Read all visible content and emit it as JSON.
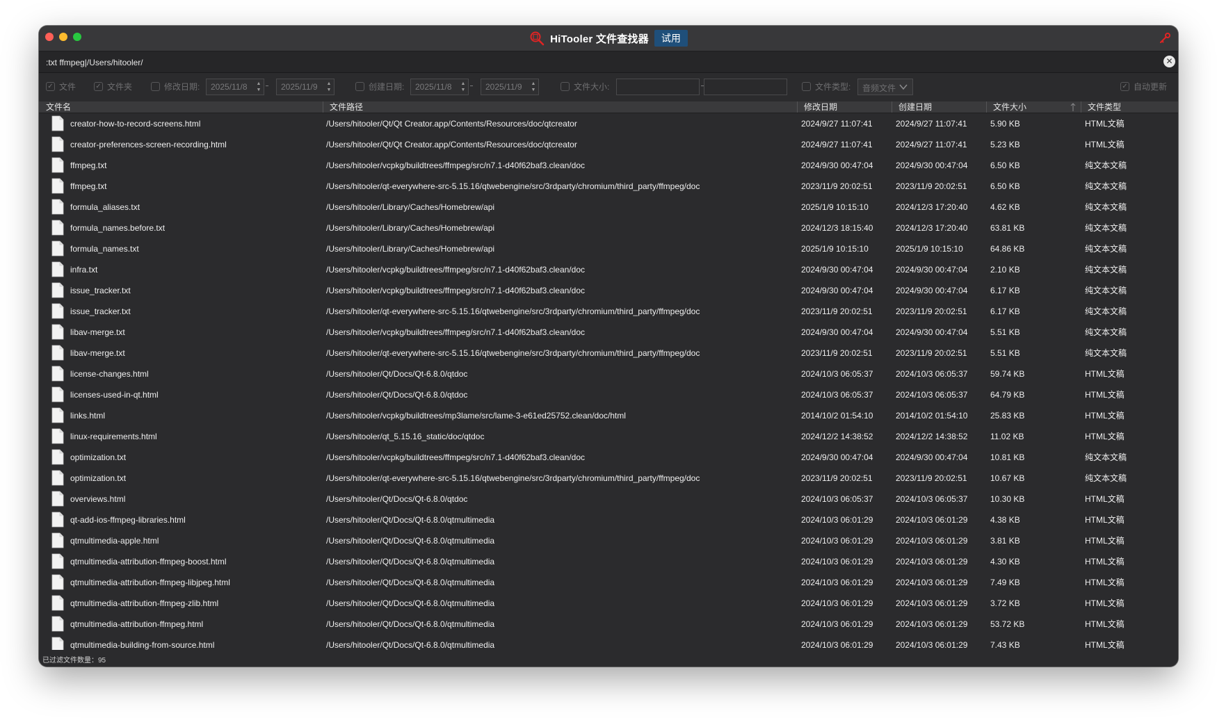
{
  "window": {
    "title": "HiTooler 文件查找器",
    "trial_badge": "试用",
    "icons": {
      "app": "magnifier-document-icon",
      "key": "key-icon",
      "clear": "close-circle-icon"
    }
  },
  "search": {
    "value": ":txt ffmpeg|/Users/hitooler/"
  },
  "filters": {
    "file": {
      "label": "文件",
      "checked": true
    },
    "folder": {
      "label": "文件夹",
      "checked": true
    },
    "modified": {
      "label": "修改日期:",
      "checked": false,
      "from": "2025/11/8",
      "to": "2025/11/9"
    },
    "created": {
      "label": "创建日期:",
      "checked": false,
      "from": "2025/11/8",
      "to": "2025/11/9"
    },
    "size": {
      "label": "文件大小:",
      "checked": false,
      "min": "",
      "max": ""
    },
    "type": {
      "label": "文件类型:",
      "checked": false,
      "selected": "音频文件"
    },
    "auto_refresh": {
      "label": "自动更新",
      "checked": true
    }
  },
  "columns": {
    "name": "文件名",
    "path": "文件路径",
    "modified": "修改日期",
    "created": "创建日期",
    "size": "文件大小",
    "type": "文件类型"
  },
  "rows": [
    {
      "name": "creator-how-to-record-screens.html",
      "path": "/Users/hitooler/Qt/Qt Creator.app/Contents/Resources/doc/qtcreator",
      "modified": "2024/9/27 11:07:41",
      "created": "2024/9/27 11:07:41",
      "size": "5.90 KB",
      "type": "HTML文稿"
    },
    {
      "name": "creator-preferences-screen-recording.html",
      "path": "/Users/hitooler/Qt/Qt Creator.app/Contents/Resources/doc/qtcreator",
      "modified": "2024/9/27 11:07:41",
      "created": "2024/9/27 11:07:41",
      "size": "5.23 KB",
      "type": "HTML文稿"
    },
    {
      "name": "ffmpeg.txt",
      "path": "/Users/hitooler/vcpkg/buildtrees/ffmpeg/src/n7.1-d40f62baf3.clean/doc",
      "modified": "2024/9/30 00:47:04",
      "created": "2024/9/30 00:47:04",
      "size": "6.50 KB",
      "type": "纯文本文稿"
    },
    {
      "name": "ffmpeg.txt",
      "path": "/Users/hitooler/qt-everywhere-src-5.15.16/qtwebengine/src/3rdparty/chromium/third_party/ffmpeg/doc",
      "modified": "2023/11/9 20:02:51",
      "created": "2023/11/9 20:02:51",
      "size": "6.50 KB",
      "type": "纯文本文稿"
    },
    {
      "name": "formula_aliases.txt",
      "path": "/Users/hitooler/Library/Caches/Homebrew/api",
      "modified": "2025/1/9 10:15:10",
      "created": "2024/12/3 17:20:40",
      "size": "4.62 KB",
      "type": "纯文本文稿"
    },
    {
      "name": "formula_names.before.txt",
      "path": "/Users/hitooler/Library/Caches/Homebrew/api",
      "modified": "2024/12/3 18:15:40",
      "created": "2024/12/3 17:20:40",
      "size": "63.81 KB",
      "type": "纯文本文稿"
    },
    {
      "name": "formula_names.txt",
      "path": "/Users/hitooler/Library/Caches/Homebrew/api",
      "modified": "2025/1/9 10:15:10",
      "created": "2025/1/9 10:15:10",
      "size": "64.86 KB",
      "type": "纯文本文稿"
    },
    {
      "name": "infra.txt",
      "path": "/Users/hitooler/vcpkg/buildtrees/ffmpeg/src/n7.1-d40f62baf3.clean/doc",
      "modified": "2024/9/30 00:47:04",
      "created": "2024/9/30 00:47:04",
      "size": "2.10 KB",
      "type": "纯文本文稿"
    },
    {
      "name": "issue_tracker.txt",
      "path": "/Users/hitooler/vcpkg/buildtrees/ffmpeg/src/n7.1-d40f62baf3.clean/doc",
      "modified": "2024/9/30 00:47:04",
      "created": "2024/9/30 00:47:04",
      "size": "6.17 KB",
      "type": "纯文本文稿"
    },
    {
      "name": "issue_tracker.txt",
      "path": "/Users/hitooler/qt-everywhere-src-5.15.16/qtwebengine/src/3rdparty/chromium/third_party/ffmpeg/doc",
      "modified": "2023/11/9 20:02:51",
      "created": "2023/11/9 20:02:51",
      "size": "6.17 KB",
      "type": "纯文本文稿"
    },
    {
      "name": "libav-merge.txt",
      "path": "/Users/hitooler/vcpkg/buildtrees/ffmpeg/src/n7.1-d40f62baf3.clean/doc",
      "modified": "2024/9/30 00:47:04",
      "created": "2024/9/30 00:47:04",
      "size": "5.51 KB",
      "type": "纯文本文稿"
    },
    {
      "name": "libav-merge.txt",
      "path": "/Users/hitooler/qt-everywhere-src-5.15.16/qtwebengine/src/3rdparty/chromium/third_party/ffmpeg/doc",
      "modified": "2023/11/9 20:02:51",
      "created": "2023/11/9 20:02:51",
      "size": "5.51 KB",
      "type": "纯文本文稿"
    },
    {
      "name": "license-changes.html",
      "path": "/Users/hitooler/Qt/Docs/Qt-6.8.0/qtdoc",
      "modified": "2024/10/3 06:05:37",
      "created": "2024/10/3 06:05:37",
      "size": "59.74 KB",
      "type": "HTML文稿"
    },
    {
      "name": "licenses-used-in-qt.html",
      "path": "/Users/hitooler/Qt/Docs/Qt-6.8.0/qtdoc",
      "modified": "2024/10/3 06:05:37",
      "created": "2024/10/3 06:05:37",
      "size": "64.79 KB",
      "type": "HTML文稿"
    },
    {
      "name": "links.html",
      "path": "/Users/hitooler/vcpkg/buildtrees/mp3lame/src/lame-3-e61ed25752.clean/doc/html",
      "modified": "2014/10/2 01:54:10",
      "created": "2014/10/2 01:54:10",
      "size": "25.83 KB",
      "type": "HTML文稿"
    },
    {
      "name": "linux-requirements.html",
      "path": "/Users/hitooler/qt_5.15.16_static/doc/qtdoc",
      "modified": "2024/12/2 14:38:52",
      "created": "2024/12/2 14:38:52",
      "size": "11.02 KB",
      "type": "HTML文稿"
    },
    {
      "name": "optimization.txt",
      "path": "/Users/hitooler/vcpkg/buildtrees/ffmpeg/src/n7.1-d40f62baf3.clean/doc",
      "modified": "2024/9/30 00:47:04",
      "created": "2024/9/30 00:47:04",
      "size": "10.81 KB",
      "type": "纯文本文稿"
    },
    {
      "name": "optimization.txt",
      "path": "/Users/hitooler/qt-everywhere-src-5.15.16/qtwebengine/src/3rdparty/chromium/third_party/ffmpeg/doc",
      "modified": "2023/11/9 20:02:51",
      "created": "2023/11/9 20:02:51",
      "size": "10.67 KB",
      "type": "纯文本文稿"
    },
    {
      "name": "overviews.html",
      "path": "/Users/hitooler/Qt/Docs/Qt-6.8.0/qtdoc",
      "modified": "2024/10/3 06:05:37",
      "created": "2024/10/3 06:05:37",
      "size": "10.30 KB",
      "type": "HTML文稿"
    },
    {
      "name": "qt-add-ios-ffmpeg-libraries.html",
      "path": "/Users/hitooler/Qt/Docs/Qt-6.8.0/qtmultimedia",
      "modified": "2024/10/3 06:01:29",
      "created": "2024/10/3 06:01:29",
      "size": "4.38 KB",
      "type": "HTML文稿"
    },
    {
      "name": "qtmultimedia-apple.html",
      "path": "/Users/hitooler/Qt/Docs/Qt-6.8.0/qtmultimedia",
      "modified": "2024/10/3 06:01:29",
      "created": "2024/10/3 06:01:29",
      "size": "3.81 KB",
      "type": "HTML文稿"
    },
    {
      "name": "qtmultimedia-attribution-ffmpeg-boost.html",
      "path": "/Users/hitooler/Qt/Docs/Qt-6.8.0/qtmultimedia",
      "modified": "2024/10/3 06:01:29",
      "created": "2024/10/3 06:01:29",
      "size": "4.30 KB",
      "type": "HTML文稿"
    },
    {
      "name": "qtmultimedia-attribution-ffmpeg-libjpeg.html",
      "path": "/Users/hitooler/Qt/Docs/Qt-6.8.0/qtmultimedia",
      "modified": "2024/10/3 06:01:29",
      "created": "2024/10/3 06:01:29",
      "size": "7.49 KB",
      "type": "HTML文稿"
    },
    {
      "name": "qtmultimedia-attribution-ffmpeg-zlib.html",
      "path": "/Users/hitooler/Qt/Docs/Qt-6.8.0/qtmultimedia",
      "modified": "2024/10/3 06:01:29",
      "created": "2024/10/3 06:01:29",
      "size": "3.72 KB",
      "type": "HTML文稿"
    },
    {
      "name": "qtmultimedia-attribution-ffmpeg.html",
      "path": "/Users/hitooler/Qt/Docs/Qt-6.8.0/qtmultimedia",
      "modified": "2024/10/3 06:01:29",
      "created": "2024/10/3 06:01:29",
      "size": "53.72 KB",
      "type": "HTML文稿"
    },
    {
      "name": "qtmultimedia-building-from-source.html",
      "path": "/Users/hitooler/Qt/Docs/Qt-6.8.0/qtmultimedia",
      "modified": "2024/10/3 06:01:29",
      "created": "2024/10/3 06:01:29",
      "size": "7.43 KB",
      "type": "HTML文稿"
    }
  ],
  "status": {
    "text": "已过滤文件数量：95"
  }
}
